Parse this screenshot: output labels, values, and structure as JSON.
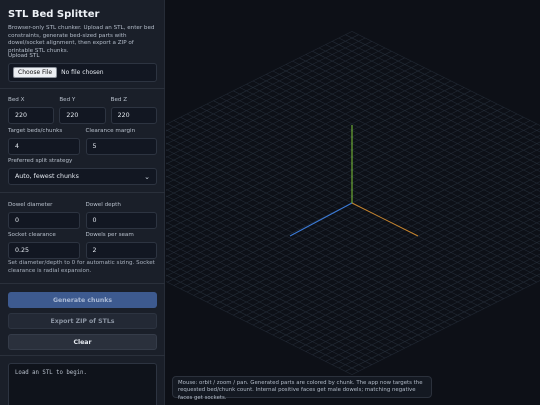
{
  "sidebar": {
    "title": "STL Bed Splitter",
    "description": "Browser-only STL chunker. Upload an STL, enter bed constraints, generate bed-sized parts with dowel/socket alignment, then export a ZIP of printable STL chunks.",
    "upload": {
      "label": "Upload STL",
      "button": "Choose File",
      "status": "No file chosen"
    },
    "bed_x": {
      "label": "Bed X",
      "value": "220"
    },
    "bed_y": {
      "label": "Bed Y",
      "value": "220"
    },
    "bed_z": {
      "label": "Bed Z",
      "value": "220"
    },
    "target_beds": {
      "label": "Target beds/chunks",
      "value": "4"
    },
    "clearance_margin": {
      "label": "Clearance margin",
      "value": "5"
    },
    "strategy": {
      "label": "Preferred split strategy",
      "value": "Auto, fewest chunks"
    },
    "dowel_diameter": {
      "label": "Dowel diameter",
      "value": "0"
    },
    "dowel_depth": {
      "label": "Dowel depth",
      "value": "0"
    },
    "socket_clearance": {
      "label": "Socket clearance",
      "value": "0.25"
    },
    "dowels_per_seam": {
      "label": "Dowels per seam",
      "value": "2"
    },
    "note": "Set diameter/depth to 0 for automatic sizing. Socket clearance is radial expansion.",
    "buttons": {
      "generate": "Generate chunks",
      "export": "Export ZIP of STLs",
      "clear": "Clear"
    },
    "log": "Load an STL to begin."
  },
  "viewport": {
    "hint": "Mouse: orbit / zoom / pan. Generated parts are colored by chunk. The app now targets the requested bed/chunk count. Internal positive faces get male dowels; matching negative faces get sockets."
  },
  "colors": {
    "x_axis": "#c8862e",
    "y_axis": "#7fc93a",
    "z_axis": "#3b7bd8",
    "grid": "#232a36"
  }
}
